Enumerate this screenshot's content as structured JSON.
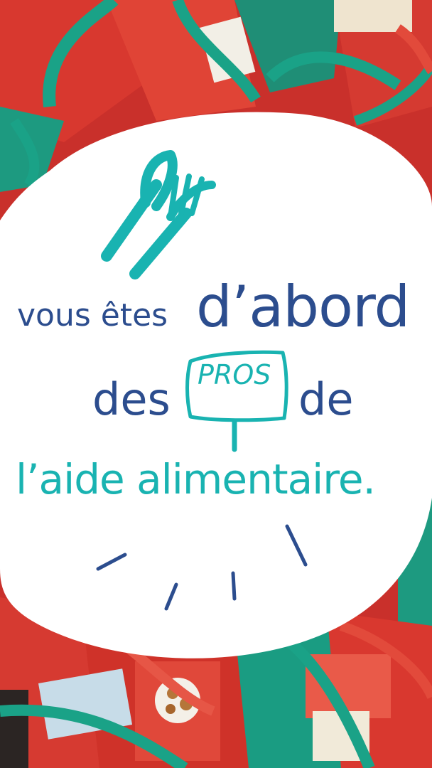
{
  "headline": {
    "line1_prefix": "vous êtes",
    "line1_emphasis": "d’abord",
    "line2_prefix": "des",
    "sign_word": "PROS",
    "line2_suffix": "de",
    "line3": "l’aide alimentaire."
  },
  "colors": {
    "navy": "#2c4d8e",
    "teal": "#19b3b1",
    "bag_red": "#d9352e",
    "bag_green": "#1a9c82",
    "circle": "#ffffff"
  },
  "icons": [
    "cutlery-icon",
    "sign-icon",
    "burst-lines-icon"
  ]
}
